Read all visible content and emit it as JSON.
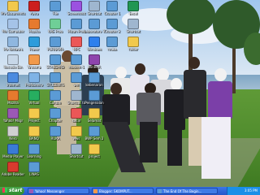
{
  "desktop": {
    "icons": [
      {
        "label": "My Documents",
        "icon": "folder-documents-icon",
        "color": "#f2c94c"
      },
      {
        "label": "My Computer",
        "icon": "computer-icon",
        "color": "#a5c3e8"
      },
      {
        "label": "My Network",
        "icon": "network-icon",
        "color": "#8fb7e0"
      },
      {
        "label": "Recycle Bin",
        "icon": "recycle-bin-icon",
        "color": "#c7d7e8"
      },
      {
        "label": "Internet",
        "icon": "internet-explorer-icon",
        "color": "#4b8be0"
      },
      {
        "label": "Mozilla",
        "icon": "firefox-icon",
        "color": "#e67a2e"
      },
      {
        "label": "Yahoo! Msgr",
        "icon": "messenger-icon",
        "color": "#9b59b6"
      },
      {
        "label": "Nero",
        "icon": "disc-icon",
        "color": "#d0d0d0"
      },
      {
        "label": "Media Player",
        "icon": "media-player-icon",
        "color": "#3a7bd5"
      },
      {
        "label": "Adobe Reader",
        "icon": "pdf-icon",
        "color": "#d93a2e"
      },
      {
        "label": "Avira",
        "icon": "antivirus-icon",
        "color": "#cc1f1f"
      },
      {
        "label": "Mozilla",
        "icon": "firefox-icon",
        "color": "#e67a2e"
      },
      {
        "label": "Power",
        "icon": "power-icon",
        "color": "#2d9cdb"
      },
      {
        "label": "Winamp",
        "icon": "music-icon",
        "color": "#f2994a"
      },
      {
        "label": "Proficiency",
        "icon": "document-icon",
        "color": "#7fb3e6"
      },
      {
        "label": "Virtual",
        "icon": "app-icon",
        "color": "#27ae60"
      },
      {
        "label": "Project",
        "icon": "folder-icon",
        "color": "#f2c94c"
      },
      {
        "label": "BANQ",
        "icon": "folder-icon",
        "color": "#f2c94c"
      },
      {
        "label": "Learning",
        "icon": "document-icon",
        "color": "#5b9bd5"
      },
      {
        "label": "LINAS",
        "icon": "document-icon",
        "color": "#5b9bd5"
      },
      {
        "label": "File",
        "icon": "document-icon",
        "color": "#5b9bd5"
      },
      {
        "label": "KAE Prog",
        "icon": "app-icon",
        "color": "#6fcf97"
      },
      {
        "label": "PURNAMA",
        "icon": "document-icon",
        "color": "#5b9bd5"
      },
      {
        "label": "STANDARD",
        "icon": "document-icon",
        "color": "#5b9bd5"
      },
      {
        "label": "STUDENTS",
        "icon": "document-icon",
        "color": "#5b9bd5"
      },
      {
        "label": "Contoh",
        "icon": "document-icon",
        "color": "#5b9bd5"
      },
      {
        "label": "Chapter",
        "icon": "document-icon",
        "color": "#5b9bd5"
      },
      {
        "label": "RUKA",
        "icon": "document-icon",
        "color": "#5b9bd5"
      },
      {
        "label": "Screenshot",
        "icon": "image-icon",
        "color": "#9b51e0"
      },
      {
        "label": "Mizan Prog",
        "icon": "document-icon",
        "color": "#5b9bd5"
      },
      {
        "label": "MPC",
        "icon": "app-icon",
        "color": "#eb5757"
      },
      {
        "label": "student-1",
        "icon": "document-icon",
        "color": "#5b9bd5"
      },
      {
        "label": "wm",
        "icon": "document-icon",
        "color": "#5b9bd5"
      },
      {
        "label": "Shortcut to",
        "icon": "shortcut-icon",
        "color": "#9fb6cf"
      },
      {
        "label": "kacin",
        "icon": "app-icon",
        "color": "#eb5757"
      },
      {
        "label": "wws",
        "icon": "folder-icon",
        "color": "#f2c94c"
      },
      {
        "label": "Shortcut",
        "icon": "shortcut-icon",
        "color": "#9fb6cf"
      },
      {
        "label": "Shortcut",
        "icon": "shortcut-icon",
        "color": "#9fb6cf"
      },
      {
        "label": "Laboratory 7",
        "icon": "document-icon",
        "color": "#5b9bd5"
      },
      {
        "label": "Windows",
        "icon": "windows-icon",
        "color": "#2f80ed"
      },
      {
        "label": "WinRAR",
        "icon": "archive-icon",
        "color": "#8e44ad"
      },
      {
        "label": "kebenaran",
        "icon": "document-icon",
        "color": "#5b9bd5"
      },
      {
        "label": "Pengenalan",
        "icon": "document-icon",
        "color": "#5b9bd5"
      },
      {
        "label": "Selamat",
        "icon": "folder-icon",
        "color": "#f2c94c"
      },
      {
        "label": "BWP Sem 2",
        "icon": "document-icon",
        "color": "#5b9bd5"
      },
      {
        "label": "project",
        "icon": "folder-icon",
        "color": "#f2c94c"
      },
      {
        "label": "Chapter 1",
        "icon": "document-icon",
        "color": "#5b9bd5"
      },
      {
        "label": "Chapter 2",
        "icon": "document-icon",
        "color": "#5b9bd5"
      },
      {
        "label": "muka",
        "icon": "document-icon",
        "color": "#5b9bd5"
      },
      {
        "label": "Excel",
        "icon": "excel-icon",
        "color": "#219653"
      },
      {
        "label": "Shortcut",
        "icon": "shortcut-icon",
        "color": "#9fb6cf"
      },
      {
        "label": "folder",
        "icon": "folder-icon",
        "color": "#f2c94c"
      }
    ]
  },
  "taskbar": {
    "start_label": "start",
    "tasks": [
      {
        "label": "Yahoo! Messenger",
        "icon": "messenger-icon",
        "color": "#9b59b6"
      },
      {
        "label": "Blogger: SKOMPUT...",
        "icon": "blogger-icon",
        "color": "#f2994a"
      },
      {
        "label": "The End Of The Begin...",
        "icon": "document-icon",
        "color": "#5b9bd5"
      }
    ],
    "clock": "3:05 PM"
  },
  "colors": {
    "taskbar": "#2456c9",
    "start": "#3a9a3a",
    "tray": "#1b8fe7"
  }
}
